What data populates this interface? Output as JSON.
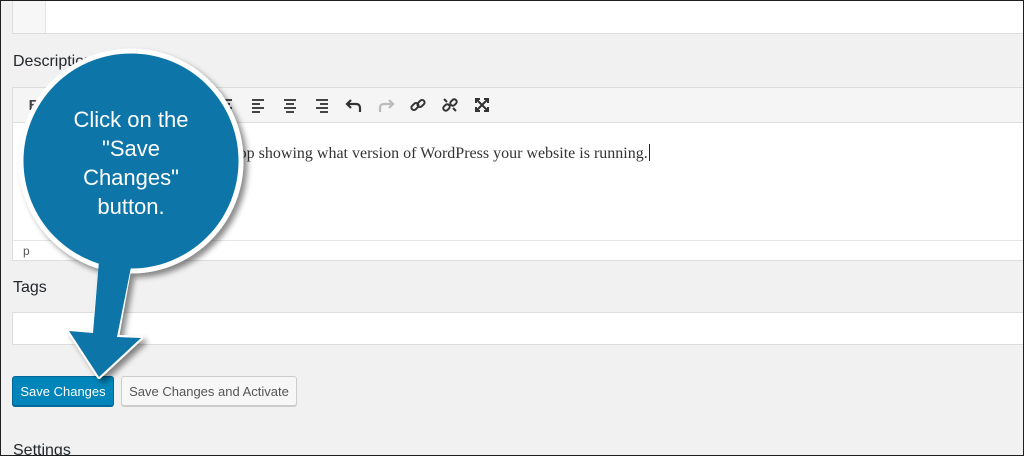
{
  "form": {
    "description_label": "Description",
    "description_text": "stop showing what version of WordPress your website is running.",
    "status_path": "p",
    "tags_label": "Tags",
    "tags_value": "",
    "settings_label": "Settings"
  },
  "toolbar": {
    "icons": [
      "bold-icon",
      "align-center-icon",
      "align-left-icon",
      "align-center-icon",
      "align-right-icon",
      "undo-icon",
      "redo-icon",
      "link-icon",
      "unlink-icon",
      "fullscreen-icon"
    ]
  },
  "buttons": {
    "save_label": "Save Changes",
    "save_activate_label": "Save Changes and Activate"
  },
  "callout": {
    "line1": "Click on the",
    "line2": "\"Save",
    "line3": "Changes\"",
    "line4": "button."
  },
  "colors": {
    "primary_button": "#0085ba",
    "callout_fill": "#0a74a8"
  }
}
